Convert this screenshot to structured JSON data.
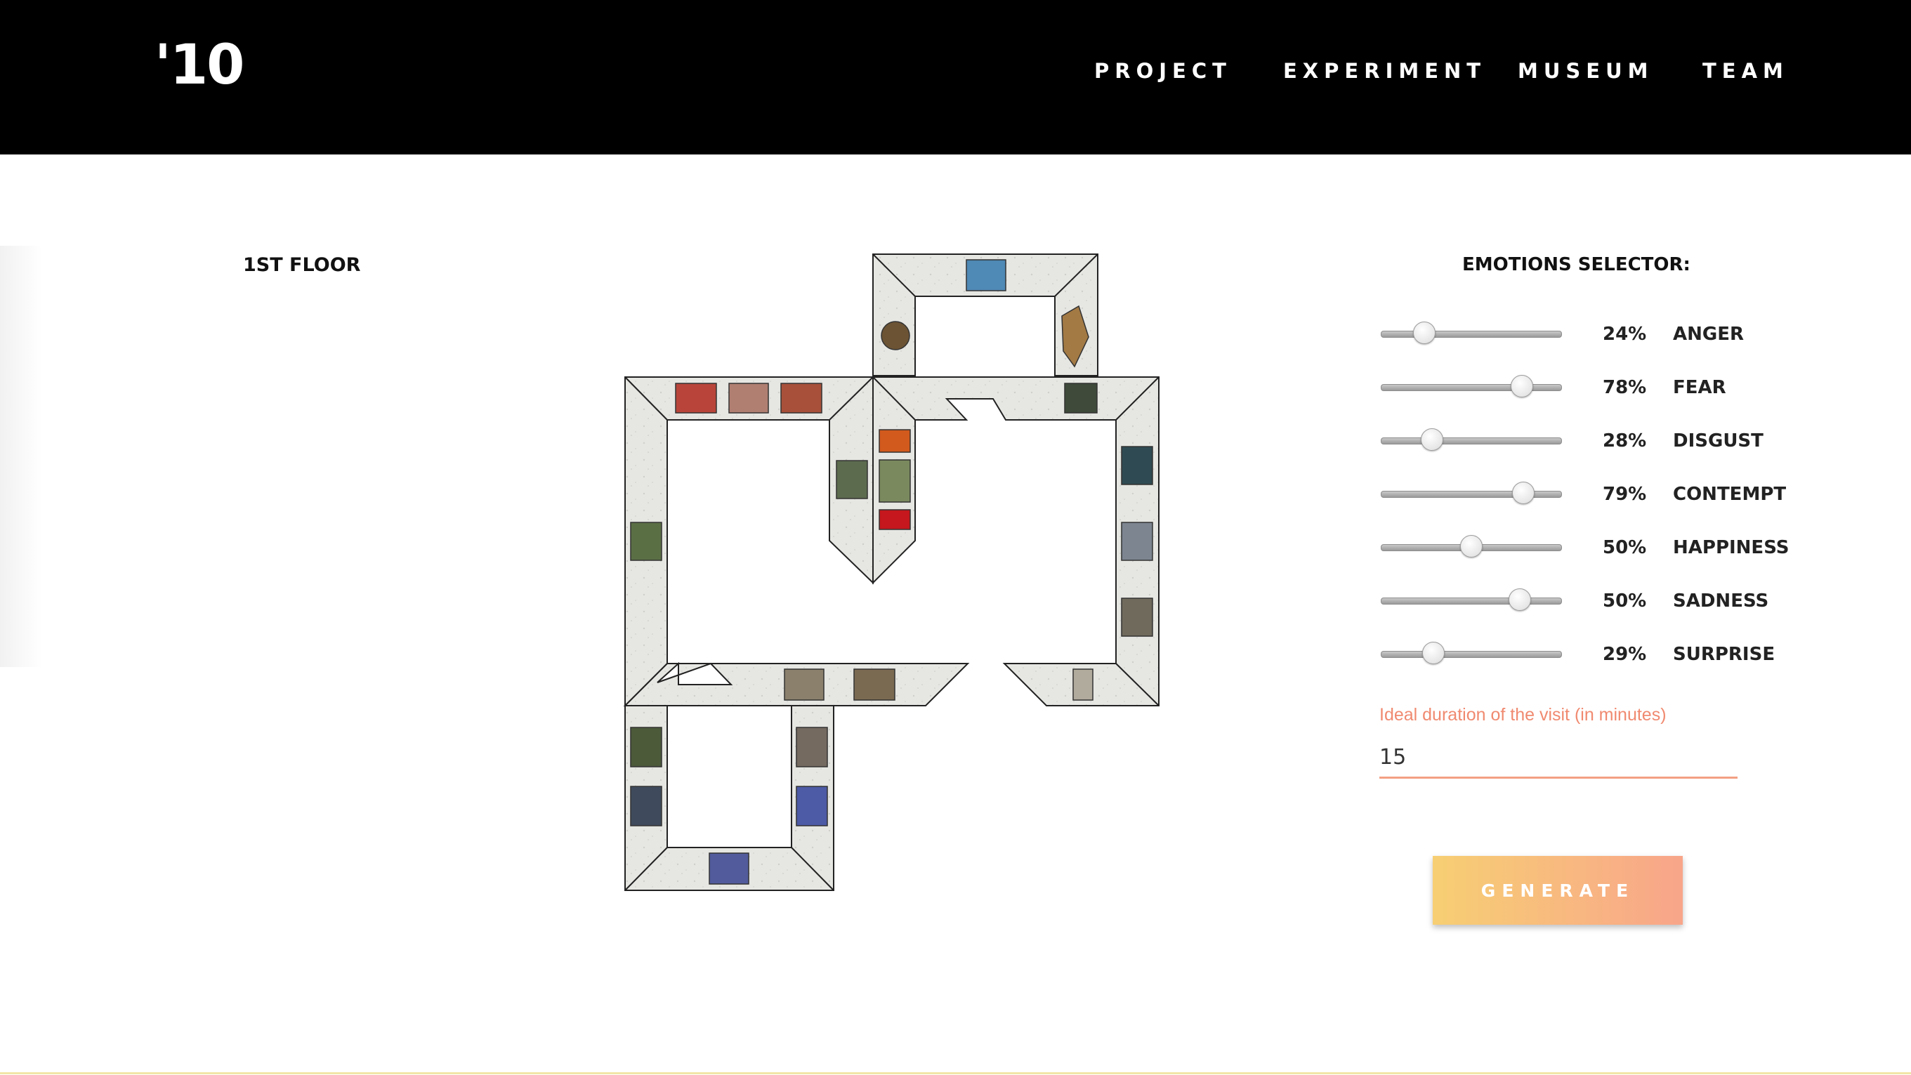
{
  "header": {
    "logo": "'10",
    "nav": [
      "PROJECT",
      "EXPERIMENT",
      "MUSEUM",
      "TEAM"
    ]
  },
  "floor": {
    "label": "1ST FLOOR"
  },
  "emotions": {
    "title": "EMOTIONS SELECTOR:",
    "items": [
      {
        "name": "ANGER",
        "percent": "24%",
        "level": 0.24
      },
      {
        "name": "FEAR",
        "percent": "78%",
        "level": 0.78
      },
      {
        "name": "DISGUST",
        "percent": "28%",
        "level": 0.28
      },
      {
        "name": "CONTEMPT",
        "percent": "79%",
        "level": 0.79
      },
      {
        "name": "HAPPINESS",
        "percent": "50%",
        "level": 0.5
      },
      {
        "name": "SADNESS",
        "percent": "50%",
        "level": 0.77
      },
      {
        "name": "SURPRISE",
        "percent": "29%",
        "level": 0.29
      }
    ]
  },
  "duration": {
    "label": "Ideal duration of the visit (in minutes)",
    "value": "15"
  },
  "generate_label": "GENERATE",
  "colors": {
    "accent_label": "#f08a70",
    "underline": "#f3a083",
    "button_gradient_start": "#f7cf73",
    "button_gradient_end": "#f8a58a",
    "header_bg": "#000000"
  }
}
